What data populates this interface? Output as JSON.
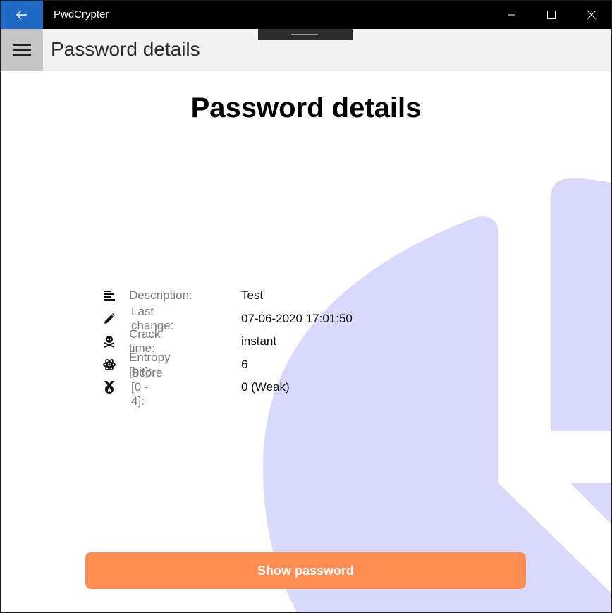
{
  "window": {
    "app_title": "PwdCrypter"
  },
  "header": {
    "title": "Password details"
  },
  "main": {
    "heading": "Password details",
    "details": [
      {
        "icon": "align-left-icon",
        "label": "Description:",
        "value": "Test"
      },
      {
        "icon": "pencil-icon",
        "label": "Last change:",
        "value": "07-06-2020 17:01:50"
      },
      {
        "icon": "skull-crossbones-icon",
        "label": "Crack time:",
        "value": "instant"
      },
      {
        "icon": "atom-icon",
        "label": "Entropy [bit]:",
        "value": "6"
      },
      {
        "icon": "medal-icon",
        "label": "Score [0 - 4]:",
        "value": "0 (Weak)"
      }
    ],
    "show_password_label": "Show password"
  },
  "colors": {
    "back_button": "#1f68c4",
    "titlebar": "#000000",
    "header_bar": "#f2f2f2",
    "hamburger_bg": "#c6c6c6",
    "background_shape": "#d9d9fc",
    "accent_button": "#ff8c50"
  }
}
